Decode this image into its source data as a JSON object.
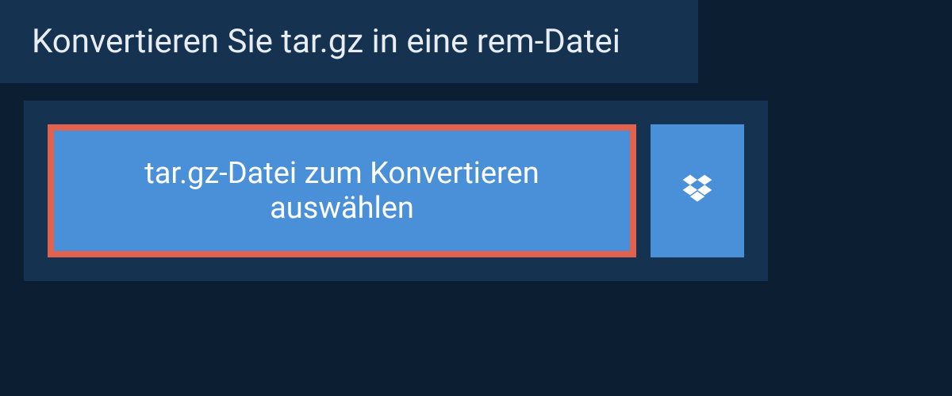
{
  "header": {
    "title": "Konvertieren Sie tar.gz in eine rem-Datei"
  },
  "upload": {
    "select_label": "tar.gz-Datei zum Konvertieren auswählen"
  },
  "colors": {
    "page_bg": "#0c1f32",
    "panel_bg": "#153350",
    "button_bg": "#4a90d9",
    "highlight_border": "#e0624f",
    "text_light": "#e8edf2",
    "text_white": "#ffffff"
  }
}
